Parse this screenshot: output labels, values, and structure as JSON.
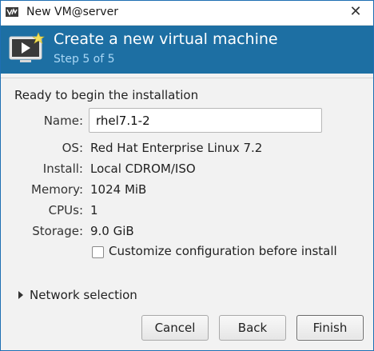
{
  "window": {
    "title": "New VM@server",
    "close_glyph": "✕"
  },
  "header": {
    "title": "Create a new virtual machine",
    "step": "Step 5 of 5",
    "background": "#1d6fa3"
  },
  "summary": {
    "ready_text": "Ready to begin the installation",
    "name_label": "Name:",
    "name_value": "rhel7.1-2",
    "os_label": "OS:",
    "os_value": "Red Hat Enterprise Linux 7.2",
    "install_label": "Install:",
    "install_value": "Local CDROM/ISO",
    "memory_label": "Memory:",
    "memory_value": "1024 MiB",
    "cpus_label": "CPUs:",
    "cpus_value": "1",
    "storage_label": "Storage:",
    "storage_value": "9.0 GiB"
  },
  "customize": {
    "label": "Customize configuration before install",
    "checked": false
  },
  "network": {
    "label": "Network selection",
    "expanded": false
  },
  "buttons": {
    "cancel": "Cancel",
    "back": "Back",
    "finish": "Finish"
  }
}
